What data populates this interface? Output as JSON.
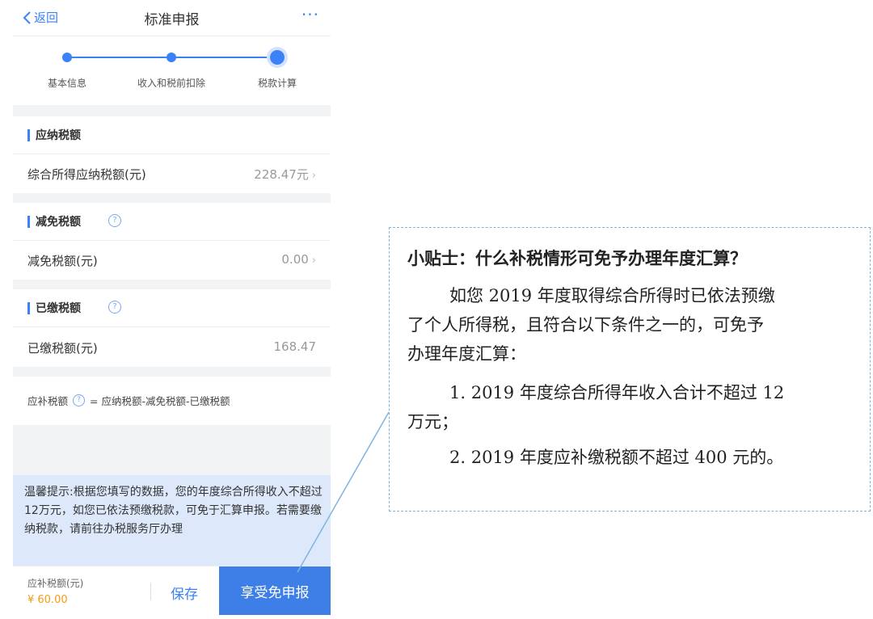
{
  "nav": {
    "back_label": "返回",
    "title": "标准申报",
    "more_label": "···"
  },
  "steps": [
    {
      "label": "基本信息"
    },
    {
      "label": "收入和税前扣除"
    },
    {
      "label": "税款计算"
    }
  ],
  "sections": {
    "payable": {
      "title": "应纳税额",
      "row_label": "综合所得应纳税额(元)",
      "row_value": "228.47元"
    },
    "reduction": {
      "title": "减免税额",
      "row_label": "减免税额(元)",
      "row_value": "0.00"
    },
    "paid": {
      "title": "已缴税额",
      "row_label": "已缴税额(元)",
      "row_value": "168.47"
    }
  },
  "formula": {
    "label": "应补税额",
    "expr": "= 应纳税额-减免税额-已缴税额"
  },
  "tip_text": "温馨提示:根据您填写的数据，您的年度综合所得收入不超过12万元，如您已依法预缴税款，可免于汇算申报。若需要缴纳税款，请前往办税服务厅办理",
  "bottom": {
    "amount_label": "应补税额(元)",
    "amount_value": "¥ 60.00",
    "save_label": "保存",
    "submit_label": "享受免申报"
  },
  "note": {
    "heading": "小贴士：什么补税情形可免予办理年度汇算？",
    "para1_line1": "如您 2019 年度取得综合所得时已依法预缴",
    "para1_line2": "了个人所得税，且符合以下条件之一的，可免予",
    "para1_line3": "办理年度汇算：",
    "item1_line1": "1. 2019 年度综合所得年收入合计不超过 12",
    "item1_line2": "万元；",
    "item2": "2. 2019 年度应补缴税额不超过 400 元的。"
  },
  "colors": {
    "accent": "#3b82f6",
    "amount": "#f39c12",
    "tip_bg": "#dde9fb"
  }
}
